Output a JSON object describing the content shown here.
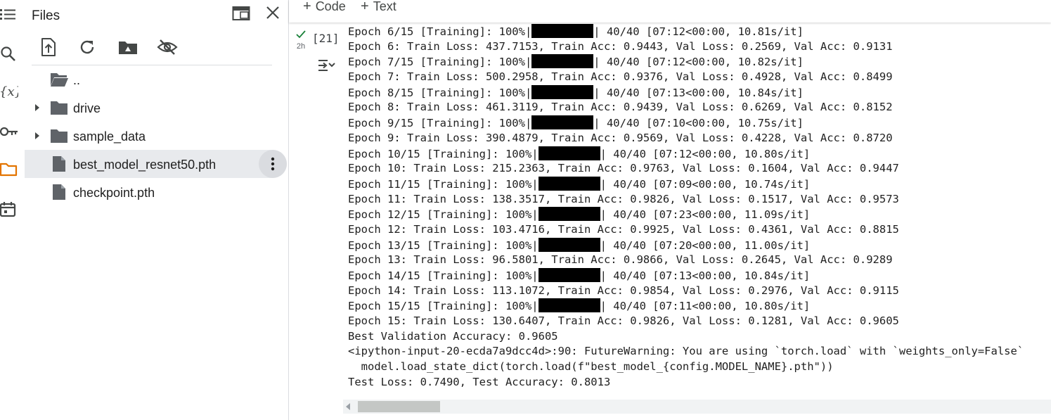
{
  "sidebar": {
    "title": "Files",
    "rail_icons": [
      "table-of-contents-icon",
      "search-icon",
      "variables-icon",
      "key-icon",
      "folder-icon",
      "calendar-icon"
    ],
    "toolbar_icons": [
      "upload-icon",
      "refresh-icon",
      "mount-drive-icon",
      "hide-files-icon"
    ],
    "items": [
      {
        "label": "..",
        "type": "folder-open",
        "expandable": false
      },
      {
        "label": "drive",
        "type": "folder",
        "expandable": true
      },
      {
        "label": "sample_data",
        "type": "folder",
        "expandable": true
      },
      {
        "label": "best_model_resnet50.pth",
        "type": "file",
        "expandable": false,
        "selected": true
      },
      {
        "label": "checkpoint.pth",
        "type": "file",
        "expandable": false
      }
    ]
  },
  "notebook": {
    "add_code_label": "Code",
    "add_text_label": "Text",
    "cell": {
      "status_time": "2h",
      "exec_count": "[21]",
      "output": {
        "lines": [
          {
            "pre": "Epoch 6/15 [Training]: 100%|",
            "bar": true,
            "post": "| 40/40 [07:12<00:00, 10.81s/it]"
          },
          {
            "pre": "Epoch 6: Train Loss: 437.7153, Train Acc: 0.9443, Val Loss: 0.2569, Val Acc: 0.9131",
            "bar": false,
            "post": ""
          },
          {
            "pre": "Epoch 7/15 [Training]: 100%|",
            "bar": true,
            "post": "| 40/40 [07:12<00:00, 10.82s/it]"
          },
          {
            "pre": "Epoch 7: Train Loss: 500.2958, Train Acc: 0.9376, Val Loss: 0.4928, Val Acc: 0.8499",
            "bar": false,
            "post": ""
          },
          {
            "pre": "Epoch 8/15 [Training]: 100%|",
            "bar": true,
            "post": "| 40/40 [07:13<00:00, 10.84s/it]"
          },
          {
            "pre": "Epoch 8: Train Loss: 461.3119, Train Acc: 0.9439, Val Loss: 0.6269, Val Acc: 0.8152",
            "bar": false,
            "post": ""
          },
          {
            "pre": "Epoch 9/15 [Training]: 100%|",
            "bar": true,
            "post": "| 40/40 [07:10<00:00, 10.75s/it]"
          },
          {
            "pre": "Epoch 9: Train Loss: 390.4879, Train Acc: 0.9569, Val Loss: 0.4228, Val Acc: 0.8720",
            "bar": false,
            "post": ""
          },
          {
            "pre": "Epoch 10/15 [Training]: 100%|",
            "bar": true,
            "post": "| 40/40 [07:12<00:00, 10.80s/it]"
          },
          {
            "pre": "Epoch 10: Train Loss: 215.2363, Train Acc: 0.9763, Val Loss: 0.1604, Val Acc: 0.9447",
            "bar": false,
            "post": ""
          },
          {
            "pre": "Epoch 11/15 [Training]: 100%|",
            "bar": true,
            "post": "| 40/40 [07:09<00:00, 10.74s/it]"
          },
          {
            "pre": "Epoch 11: Train Loss: 138.3517, Train Acc: 0.9826, Val Loss: 0.1517, Val Acc: 0.9573",
            "bar": false,
            "post": ""
          },
          {
            "pre": "Epoch 12/15 [Training]: 100%|",
            "bar": true,
            "post": "| 40/40 [07:23<00:00, 11.09s/it]"
          },
          {
            "pre": "Epoch 12: Train Loss: 103.4716, Train Acc: 0.9925, Val Loss: 0.4361, Val Acc: 0.8815",
            "bar": false,
            "post": ""
          },
          {
            "pre": "Epoch 13/15 [Training]: 100%|",
            "bar": true,
            "post": "| 40/40 [07:20<00:00, 11.00s/it]"
          },
          {
            "pre": "Epoch 13: Train Loss: 96.5801, Train Acc: 0.9866, Val Loss: 0.2645, Val Acc: 0.9289",
            "bar": false,
            "post": ""
          },
          {
            "pre": "Epoch 14/15 [Training]: 100%|",
            "bar": true,
            "post": "| 40/40 [07:13<00:00, 10.84s/it]"
          },
          {
            "pre": "Epoch 14: Train Loss: 113.1072, Train Acc: 0.9854, Val Loss: 0.2976, Val Acc: 0.9115",
            "bar": false,
            "post": ""
          },
          {
            "pre": "Epoch 15/15 [Training]: 100%|",
            "bar": true,
            "post": "| 40/40 [07:11<00:00, 10.80s/it]"
          },
          {
            "pre": "Epoch 15: Train Loss: 130.6407, Train Acc: 0.9826, Val Loss: 0.1281, Val Acc: 0.9605",
            "bar": false,
            "post": ""
          },
          {
            "pre": "Best Validation Accuracy: 0.9605",
            "bar": false,
            "post": ""
          },
          {
            "pre": "<ipython-input-20-ecda7a9dcc4d>:90: FutureWarning: You are using `torch.load` with `weights_only=False`",
            "bar": false,
            "post": ""
          },
          {
            "pre": "  model.load_state_dict(torch.load(f\"best_model_{config.MODEL_NAME}.pth\"))",
            "bar": false,
            "post": ""
          },
          {
            "pre": "Test Loss: 0.7490, Test Accuracy: 0.8013",
            "bar": false,
            "post": ""
          }
        ]
      }
    }
  }
}
